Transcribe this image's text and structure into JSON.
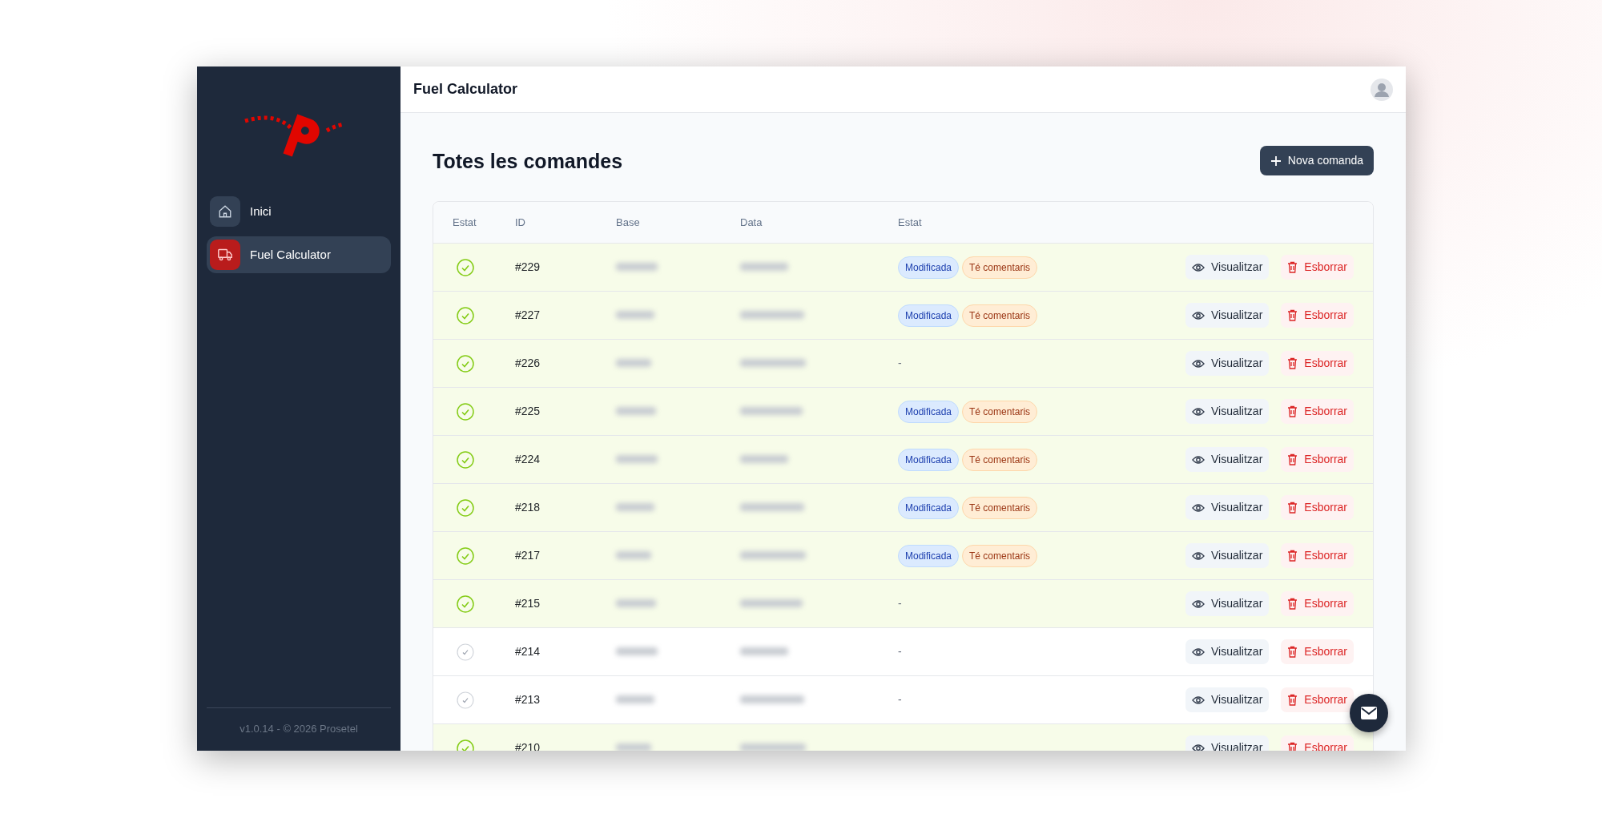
{
  "sidebar": {
    "items": [
      {
        "label": "Inici",
        "kind": "home",
        "selected": false
      },
      {
        "label": "Fuel Calculator",
        "kind": "truck",
        "selected": true
      }
    ],
    "footer": "v1.0.14 - © 2026 Prosetel"
  },
  "header": {
    "title": "Fuel Calculator"
  },
  "page": {
    "title": "Totes les comandes",
    "new_button": "Nova comanda"
  },
  "table": {
    "columns": [
      "Estat",
      "ID",
      "Base",
      "Data",
      "Estat"
    ],
    "rows": [
      {
        "done": true,
        "id": "#229",
        "tags": [
          {
            "kind": "info",
            "label": "Modificada"
          },
          {
            "kind": "warn",
            "label": "Té comentaris"
          }
        ],
        "view": "Visualitzar",
        "delete": "Esborrar"
      },
      {
        "done": true,
        "id": "#227",
        "tags": [
          {
            "kind": "info",
            "label": "Modificada"
          },
          {
            "kind": "warn",
            "label": "Té comentaris"
          }
        ],
        "view": "Visualitzar",
        "delete": "Esborrar"
      },
      {
        "done": true,
        "id": "#226",
        "empty": "-",
        "view": "Visualitzar",
        "delete": "Esborrar"
      },
      {
        "done": true,
        "id": "#225",
        "tags": [
          {
            "kind": "info",
            "label": "Modificada"
          },
          {
            "kind": "warn",
            "label": "Té comentaris"
          }
        ],
        "view": "Visualitzar",
        "delete": "Esborrar"
      },
      {
        "done": true,
        "id": "#224",
        "tags": [
          {
            "kind": "info",
            "label": "Modificada"
          },
          {
            "kind": "warn",
            "label": "Té comentaris"
          }
        ],
        "view": "Visualitzar",
        "delete": "Esborrar"
      },
      {
        "done": true,
        "id": "#218",
        "tags": [
          {
            "kind": "info",
            "label": "Modificada"
          },
          {
            "kind": "warn",
            "label": "Té comentaris"
          }
        ],
        "view": "Visualitzar",
        "delete": "Esborrar"
      },
      {
        "done": true,
        "id": "#217",
        "tags": [
          {
            "kind": "info",
            "label": "Modificada"
          },
          {
            "kind": "warn",
            "label": "Té comentaris"
          }
        ],
        "view": "Visualitzar",
        "delete": "Esborrar"
      },
      {
        "done": true,
        "id": "#215",
        "empty": "-",
        "view": "Visualitzar",
        "delete": "Esborrar"
      },
      {
        "done": false,
        "id": "#214",
        "empty": "-",
        "view": "Visualitzar",
        "delete": "Esborrar"
      },
      {
        "done": false,
        "id": "#213",
        "empty": "-",
        "view": "Visualitzar",
        "delete": "Esborrar"
      },
      {
        "done": true,
        "id": "#210",
        "view": "Visualitzar",
        "delete": "Esborrar"
      }
    ]
  }
}
